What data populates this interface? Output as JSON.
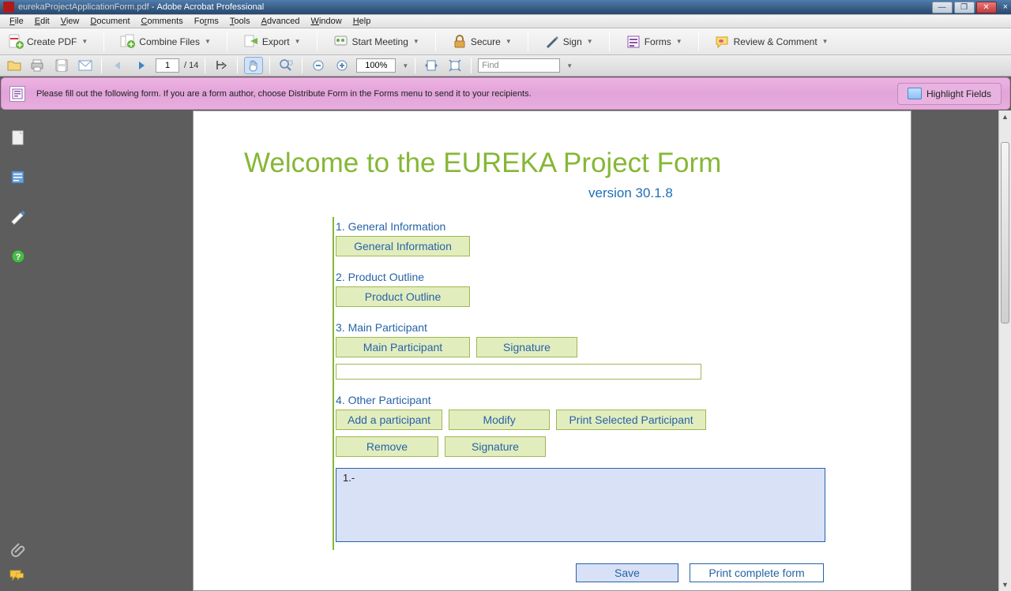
{
  "window": {
    "file_name": "eurekaProjectApplicationForm.pdf",
    "app_name": "Adobe Acrobat Professional"
  },
  "menu": [
    "File",
    "Edit",
    "View",
    "Document",
    "Comments",
    "Forms",
    "Tools",
    "Advanced",
    "Window",
    "Help"
  ],
  "toolbar1": {
    "create_pdf": "Create PDF",
    "combine": "Combine Files",
    "export": "Export",
    "start_meeting": "Start Meeting",
    "secure": "Secure",
    "sign": "Sign",
    "forms": "Forms",
    "review": "Review & Comment"
  },
  "toolbar2": {
    "page_current": "1",
    "page_total": "/ 14",
    "zoom": "100%",
    "find_placeholder": "Find"
  },
  "banner": {
    "message": "Please fill out the following form. If you are a form author, choose Distribute Form in the Forms menu to send it to your recipients.",
    "highlight_label": "Highlight Fields"
  },
  "doc": {
    "heading": "Welcome to the EUREKA Project Form",
    "version": "version 30.1.8",
    "s1_label": "1. General Information",
    "s1_btn": "General Information",
    "s2_label": "2. Product Outline",
    "s2_btn": "Product Outline",
    "s3_label": "3. Main Participant",
    "s3_btn1": "Main Participant",
    "s3_btn2": "Signature",
    "s4_label": "4. Other Participant",
    "s4_btn1": "Add a participant",
    "s4_btn2": "Modify",
    "s4_btn3": "Print Selected Participant",
    "s4_btn4": "Remove",
    "s4_btn5": "Signature",
    "list_item": "1.-",
    "save": "Save",
    "print_complete": "Print complete form"
  }
}
